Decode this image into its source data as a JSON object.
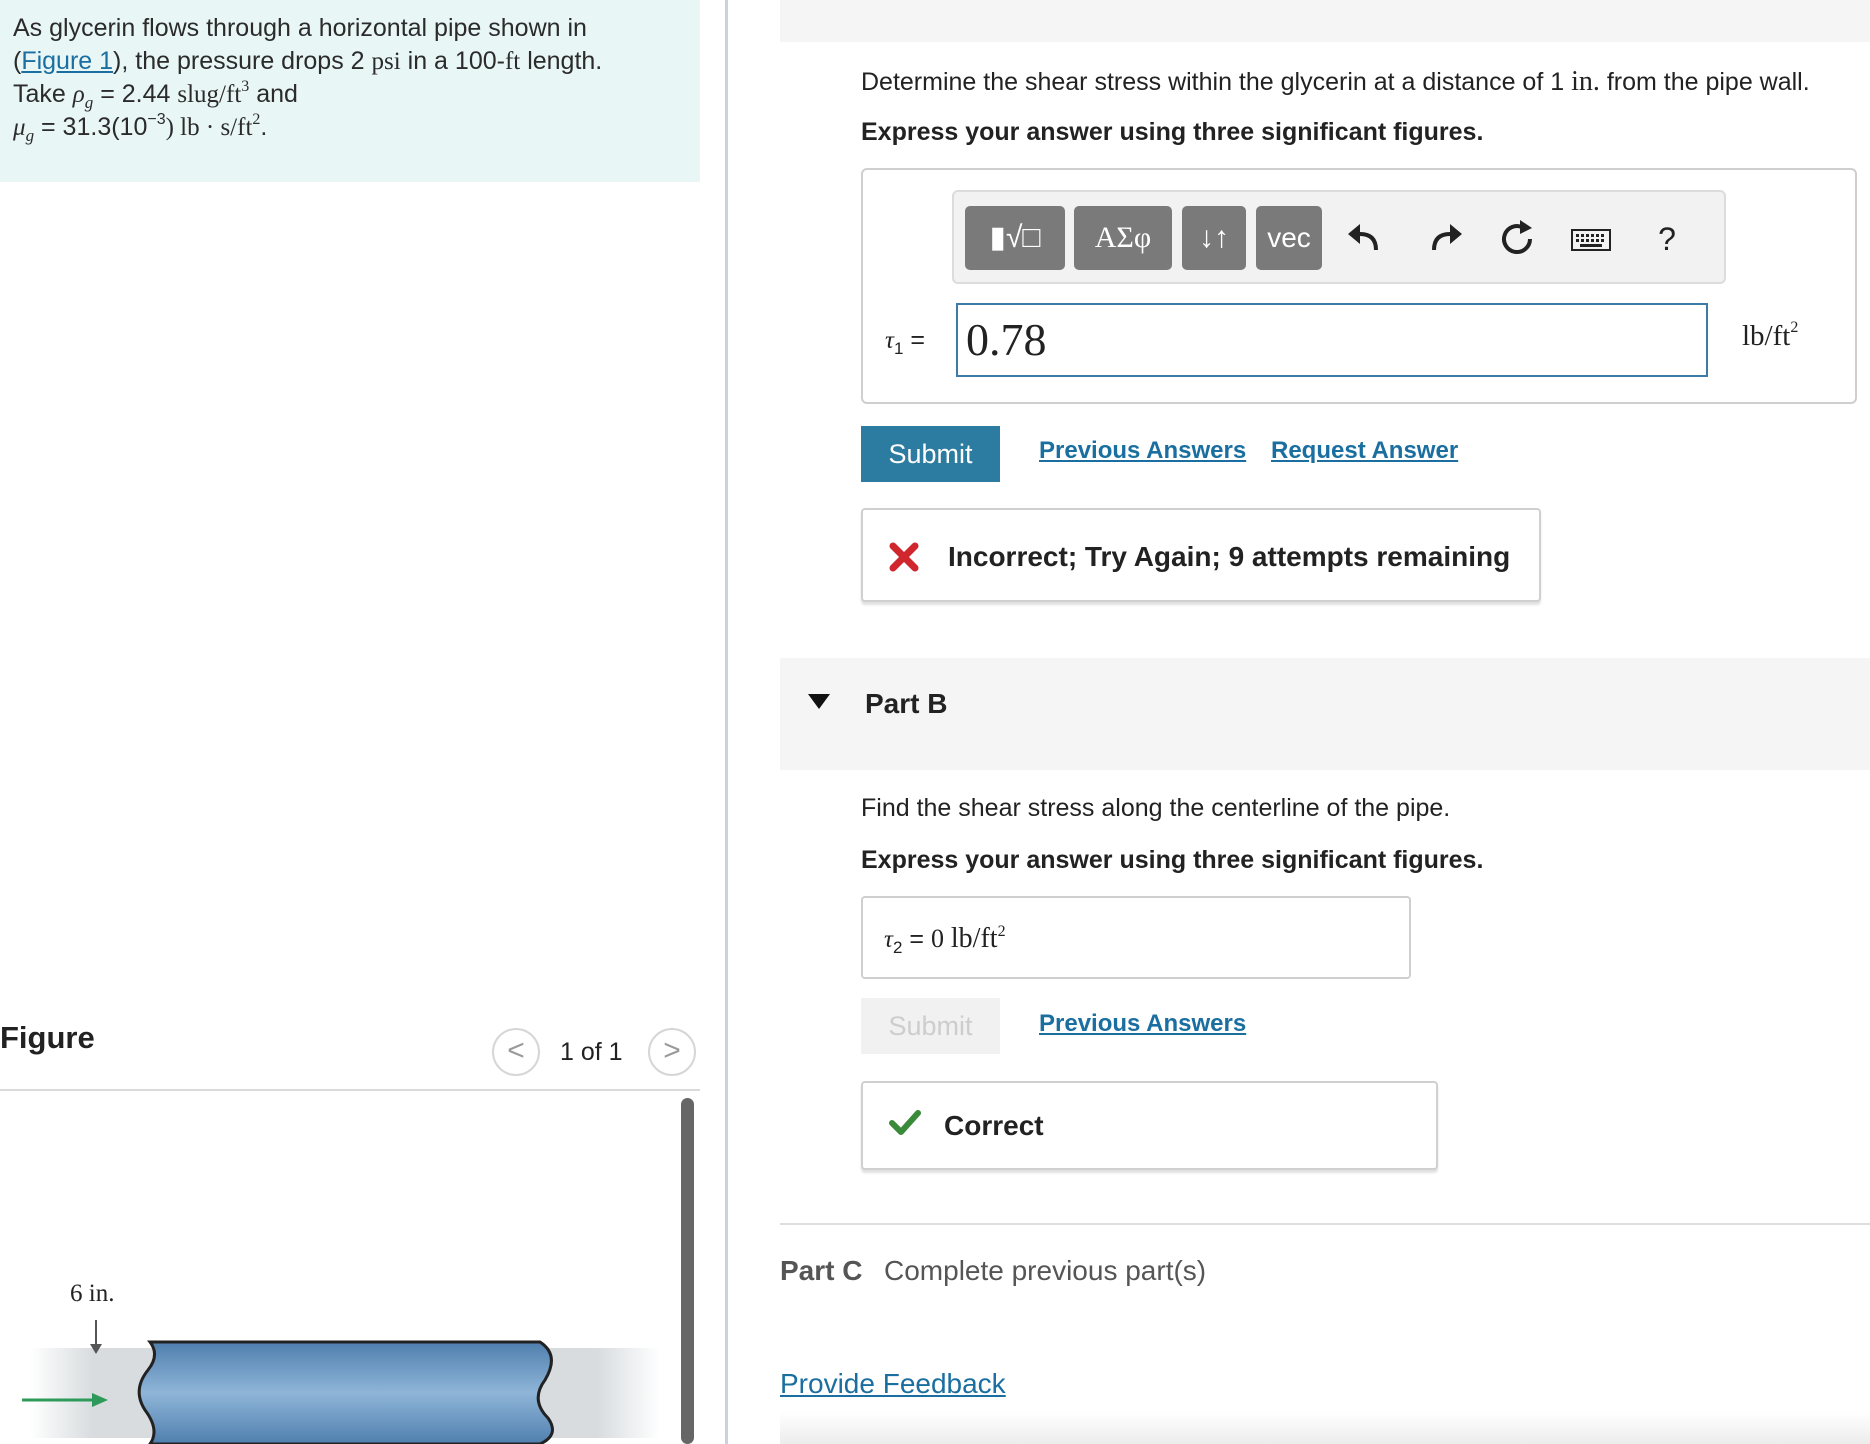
{
  "problem": {
    "line1": "As glycerin flows through a horizontal pipe shown in",
    "paren_open": "(",
    "figure_link": "Figure 1",
    "line2_rest": "), the pressure drops 2",
    "psi": "psi",
    "line2_tail": "in a 100-",
    "ft": "ft",
    "line2_end": "length.",
    "take": "Take",
    "rho": "ρ",
    "g_sub": "g",
    "rho_val": "= 2.44",
    "rho_unit": "slug/ft",
    "cube": "3",
    "and": "and",
    "mu": "μ",
    "mu_val": "= 31.3(10",
    "neg3": "−3",
    "mu_unit": ") lb · s/ft",
    "sq": "2",
    "period": "."
  },
  "figure": {
    "title": "Figure",
    "counter": "1 of 1",
    "prev_label": "<",
    "next_label": ">",
    "dimension_label": "6 in.",
    "colors": {
      "pipe_fill": "#6d9ac3",
      "arrow": "#2e9a5a"
    }
  },
  "partA": {
    "question_pre": "Determine the shear stress within the glycerin at a distance of 1",
    "in": "in.",
    "question_post": "from the pipe wall.",
    "instruction": "Express your answer using three significant figures.",
    "toolbar": {
      "template_label": "▮√□",
      "greek_label": "ΑΣφ",
      "updown_label": "↓↑",
      "vec_label": "vec",
      "help_label": "?"
    },
    "tau_symbol": "τ",
    "tau_sub": "1",
    "equals": "=",
    "answer_value": "0.78",
    "unit": "lb/ft",
    "unit_exp": "2",
    "submit_label": "Submit",
    "previous_answers_label": "Previous Answers",
    "request_answer_label": "Request Answer",
    "feedback": "Incorrect; Try Again; 9 attempts remaining",
    "feedback_color": "#d0262e"
  },
  "partB": {
    "title": "Part B",
    "question": "Find the shear stress along the centerline of the pipe.",
    "instruction": "Express your answer using three significant figures.",
    "tau_symbol": "τ",
    "tau_sub": "2",
    "equals": "=",
    "answer_value": "0",
    "unit": "lb/ft",
    "unit_exp": "2",
    "submit_label": "Submit",
    "previous_answers_label": "Previous Answers",
    "feedback": "Correct",
    "feedback_color": "#3a8a3a"
  },
  "partC": {
    "label": "Part C",
    "status": "Complete previous part(s)"
  },
  "footer": {
    "feedback_link": "Provide Feedback"
  }
}
